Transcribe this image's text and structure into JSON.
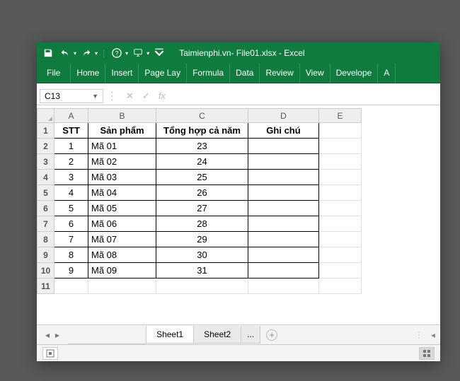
{
  "title": "Taimienphi.vn- File01.xlsx  -  Excel",
  "ribbon_tabs": [
    "File",
    "Home",
    "Insert",
    "Page Lay",
    "Formula",
    "Data",
    "Review",
    "View",
    "Develope",
    "A"
  ],
  "name_box": "C13",
  "fx_label": "fx",
  "columns": [
    "A",
    "B",
    "C",
    "D",
    "E"
  ],
  "headers": {
    "stt": "STT",
    "sp": "Sản phẩm",
    "th": "Tổng hợp cả năm",
    "gc": "Ghi chú"
  },
  "rows": [
    {
      "n": "1",
      "stt": "1",
      "sp": "Mã 01",
      "th": "23",
      "gc": ""
    },
    {
      "n": "2",
      "stt": "2",
      "sp": "Mã 02",
      "th": "24",
      "gc": ""
    },
    {
      "n": "3",
      "stt": "3",
      "sp": "Mã 03",
      "th": "25",
      "gc": ""
    },
    {
      "n": "4",
      "stt": "4",
      "sp": "Mã 04",
      "th": "26",
      "gc": ""
    },
    {
      "n": "5",
      "stt": "5",
      "sp": "Mã 05",
      "th": "27",
      "gc": ""
    },
    {
      "n": "6",
      "stt": "6",
      "sp": "Mã 06",
      "th": "28",
      "gc": ""
    },
    {
      "n": "7",
      "stt": "7",
      "sp": "Mã 07",
      "th": "29",
      "gc": ""
    },
    {
      "n": "8",
      "stt": "8",
      "sp": "Mã 08",
      "th": "30",
      "gc": ""
    },
    {
      "n": "9",
      "stt": "9",
      "sp": "Mã 09",
      "th": "31",
      "gc": ""
    }
  ],
  "empty_rows": [
    "11"
  ],
  "sheet_tabs": [
    "Sheet1",
    "Sheet2"
  ],
  "dots": "...",
  "chart_data": {
    "type": "table",
    "title": "Tổng hợp cả năm",
    "columns": [
      "STT",
      "Sản phẩm",
      "Tổng hợp cả năm",
      "Ghi chú"
    ],
    "data": [
      [
        1,
        "Mã 01",
        23,
        ""
      ],
      [
        2,
        "Mã 02",
        24,
        ""
      ],
      [
        3,
        "Mã 03",
        25,
        ""
      ],
      [
        4,
        "Mã 04",
        26,
        ""
      ],
      [
        5,
        "Mã 05",
        27,
        ""
      ],
      [
        6,
        "Mã 06",
        28,
        ""
      ],
      [
        7,
        "Mã 07",
        29,
        ""
      ],
      [
        8,
        "Mã 08",
        30,
        ""
      ],
      [
        9,
        "Mã 09",
        31,
        ""
      ]
    ]
  }
}
